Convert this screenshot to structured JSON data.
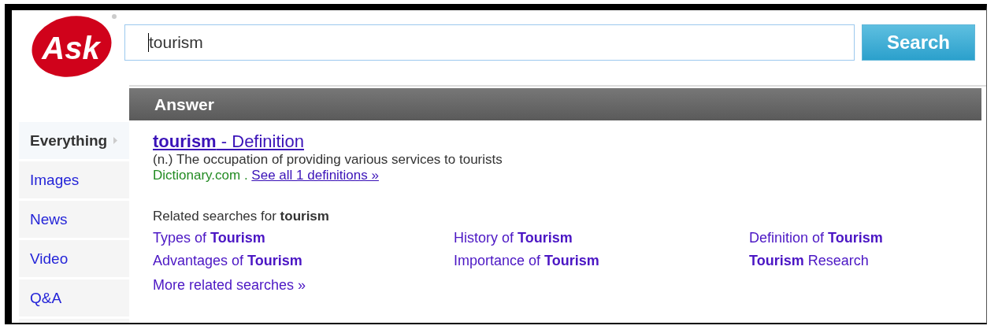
{
  "logo": {
    "text": "Ask"
  },
  "search": {
    "value": "tourism",
    "button": "Search"
  },
  "sidebar": {
    "items": [
      {
        "label": "Everything",
        "selected": true
      },
      {
        "label": "Images",
        "selected": false
      },
      {
        "label": "News",
        "selected": false
      },
      {
        "label": "Video",
        "selected": false
      },
      {
        "label": "Q&A",
        "selected": false
      }
    ]
  },
  "answer": {
    "header": "Answer",
    "title": "**tourism** - Definition",
    "definition": "(n.) The occupation of providing various services to tourists",
    "source": "Dictionary.com .",
    "see_all": "See all 1 definitions »"
  },
  "related": {
    "heading": "Related searches for **tourism**",
    "items": [
      "Types of **Tourism**",
      "History of **Tourism**",
      "Definition of **Tourism**",
      "Advantages of **Tourism**",
      "Importance of **Tourism**",
      "**Tourism** Research"
    ],
    "more": "More related searches »"
  }
}
